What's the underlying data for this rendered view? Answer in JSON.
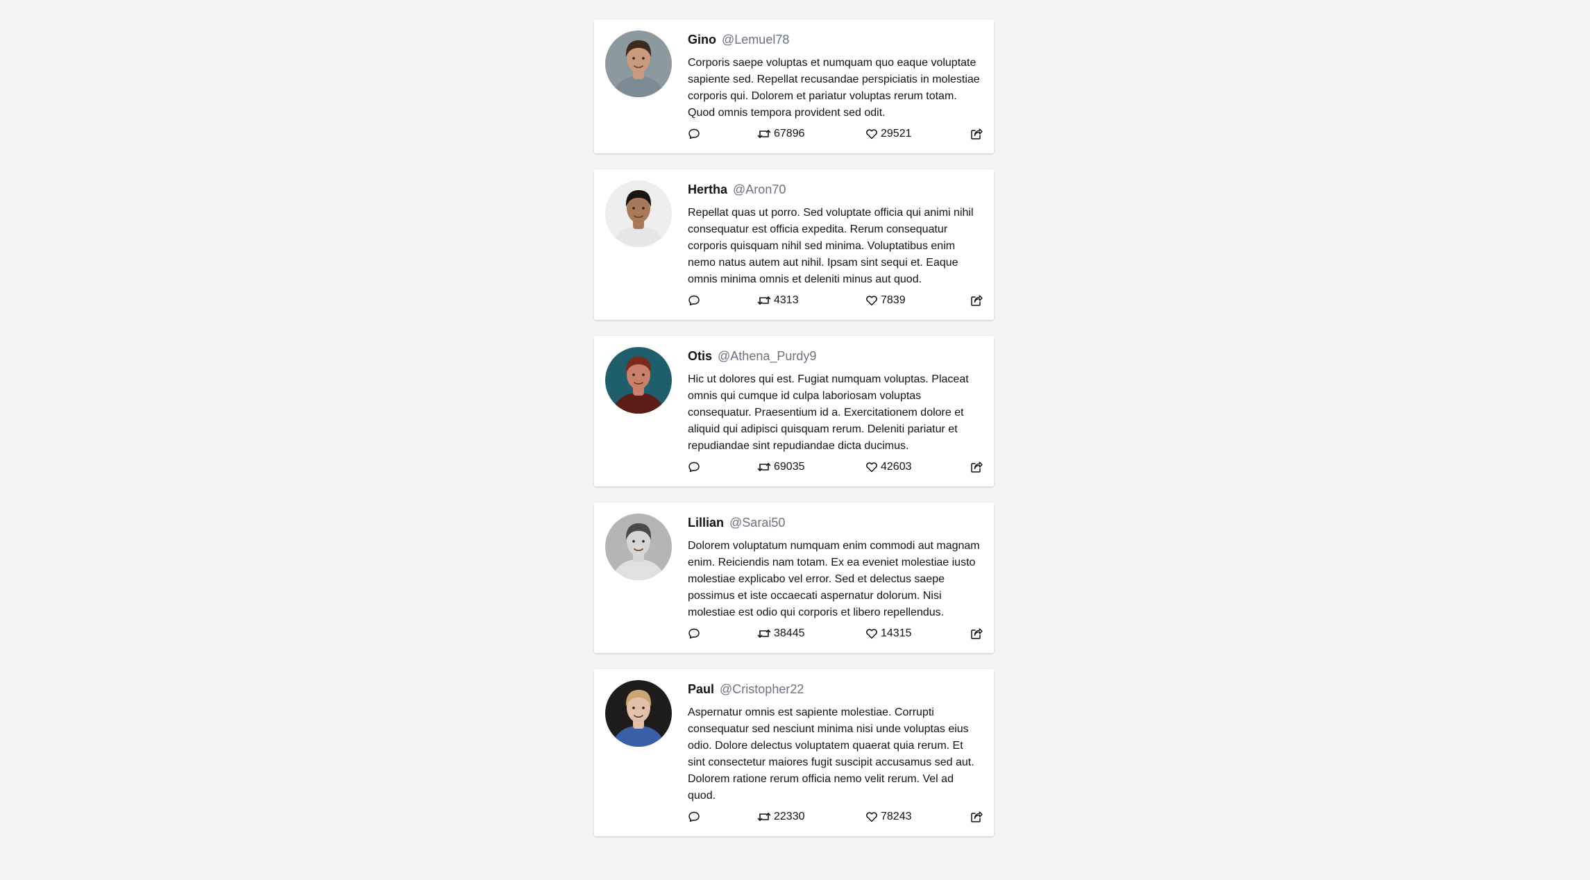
{
  "tweets": [
    {
      "name": "Gino",
      "handle": "@Lemuel78",
      "text": "Corporis saepe voluptas et numquam quo eaque voluptate sapiente sed. Repellat recusandae perspiciatis in molestiae corporis qui. Dolorem et pariatur voluptas rerum totam. Quod omnis tempora provident sed odit.",
      "retweets": "67896",
      "likes": "29521",
      "avatar": {
        "bg": "#8c9aa0",
        "skin": "#c99a7d",
        "hair": "#3d2a1e",
        "shirt": "#7d8b95"
      }
    },
    {
      "name": "Hertha",
      "handle": "@Aron70",
      "text": "Repellat quas ut porro. Sed voluptate officia qui animi nihil consequatur est officia expedita. Rerum consequatur corporis quisquam nihil sed minima. Voluptatibus enim nemo natus autem aut nihil. Ipsam sint sequi et. Eaque omnis minima omnis et deleniti minus aut quod.",
      "retweets": "4313",
      "likes": "7839",
      "avatar": {
        "bg": "#eeeeee",
        "skin": "#a8785a",
        "hair": "#1a1410",
        "shirt": "#e6e6e6"
      }
    },
    {
      "name": "Otis",
      "handle": "@Athena_Purdy9",
      "text": "Hic ut dolores qui est. Fugiat numquam voluptas. Placeat omnis qui cumque id culpa laboriosam voluptas consequatur. Praesentium id a. Exercitationem dolore et aliquid qui adipisci quisquam rerum. Deleniti pariatur et repudiandae sint repudiandae dicta ducimus.",
      "retweets": "69035",
      "likes": "42603",
      "avatar": {
        "bg": "#1f5f6b",
        "skin": "#c97f6a",
        "hair": "#7a2b1c",
        "shirt": "#5a1e16"
      }
    },
    {
      "name": "Lillian",
      "handle": "@Sarai50",
      "text": "Dolorem voluptatum numquam enim commodi aut magnam enim. Reiciendis nam totam. Ex ea eveniet molestiae iusto molestiae explicabo vel error. Sed et delectus saepe possimus et iste occaecati aspernatur dolorum. Nisi molestiae est odio qui corporis et libero repellendus.",
      "retweets": "38445",
      "likes": "14315",
      "avatar": {
        "bg": "#b5b5b5",
        "skin": "#d6d6d6",
        "hair": "#4a4a4a",
        "shirt": "#e0e0e0"
      }
    },
    {
      "name": "Paul",
      "handle": "@Cristopher22",
      "text": "Aspernatur omnis est sapiente molestiae. Corrupti consequatur sed nesciunt minima nisi unde voluptas eius odio. Dolore delectus voluptatem quaerat quia rerum. Et sint consectetur maiores fugit suscipit accusamus sed aut. Dolorem ratione rerum officia nemo velit rerum. Vel ad quod.",
      "retweets": "22330",
      "likes": "78243",
      "avatar": {
        "bg": "#1e1c1a",
        "skin": "#e2bfa8",
        "hair": "#c9a671",
        "shirt": "#3a5ea8"
      }
    }
  ],
  "icons": {
    "comment": "comment-icon",
    "retweet": "retweet-icon",
    "like": "heart-icon",
    "share": "share-icon"
  }
}
